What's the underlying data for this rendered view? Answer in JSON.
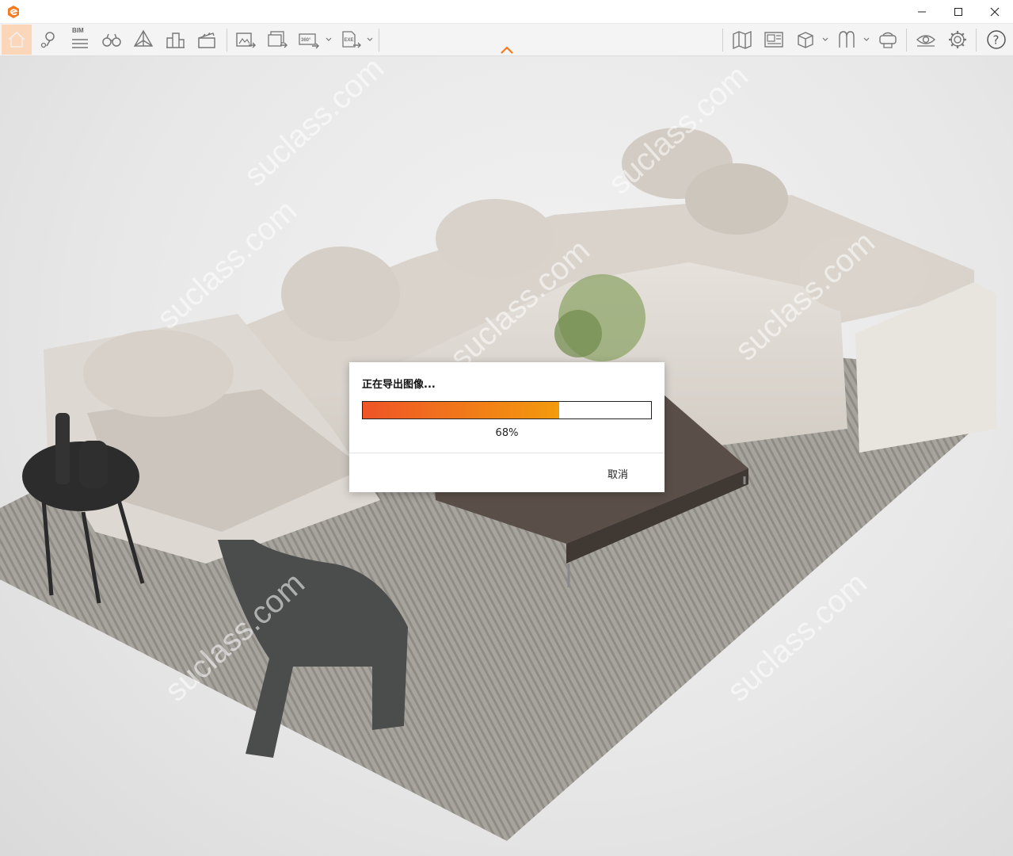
{
  "window": {
    "logo_icon": "app-logo-icon",
    "controls": {
      "minimize_icon": "minimize-icon",
      "maximize_icon": "maximize-icon",
      "close_icon": "close-icon"
    }
  },
  "toolbar": {
    "bim_label": "BIM",
    "accent_color": "#f47b20",
    "active_tool_bg": "#fbd6b9",
    "left_tools": [
      "home-icon",
      "location-pin-icon",
      "bim-icon",
      "binoculars-icon",
      "perspective-icon",
      "buildings-icon",
      "clapperboard-icon"
    ],
    "export_tools": [
      "export-image-icon",
      "export-batch-icon",
      "export-360-icon",
      "export-exe-icon"
    ],
    "export_360_label": "360°",
    "export_exe_label": "EXE",
    "right_tools": [
      "map-icon",
      "map-view-icon",
      "box-view-icon",
      "lasso-icon",
      "vr-icon",
      "visibility-icon",
      "settings-icon",
      "help-icon"
    ],
    "help_label": "?"
  },
  "scene": {
    "watermark_text": "suclass.com"
  },
  "dialog": {
    "title": "正在导出图像...",
    "progress_percent": 68,
    "progress_label": "68%",
    "cancel_label": "取消",
    "progress_gradient": [
      "#ef5427",
      "#f39b0d"
    ]
  }
}
